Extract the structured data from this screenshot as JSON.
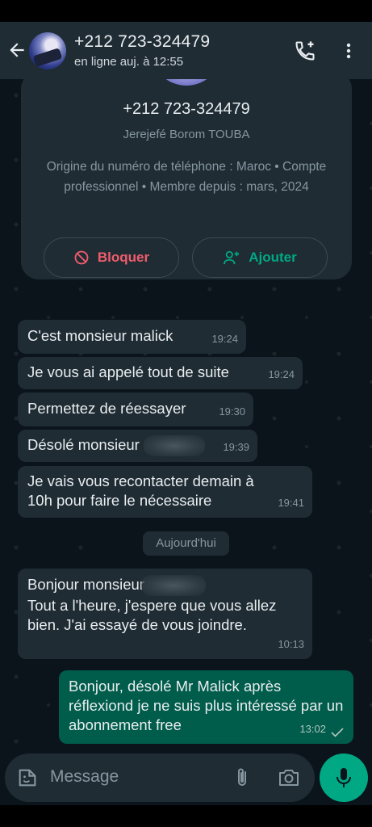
{
  "header": {
    "contact_name": "+212 723-324479",
    "status": "en ligne auj. à 12:55"
  },
  "contact_card": {
    "phone": "+212 723-324479",
    "business_name": "Jerejefé Borom TOUBA",
    "info": "Origine du numéro de téléphone : Maroc • Compte professionnel • Membre depuis : mars, 2024",
    "block_label": "Bloquer",
    "add_label": "Ajouter"
  },
  "messages": [
    {
      "text": "C'est  monsieur malick",
      "time": "19:24"
    },
    {
      "text": "Je vous ai appelé tout de suite",
      "time": "19:24"
    },
    {
      "text": "Permettez de réessayer",
      "time": "19:30"
    },
    {
      "text": "Désolé monsieur",
      "time": "19:39"
    },
    {
      "text": "Je vais vous recontacter demain à 10h pour faire le nécessaire",
      "time": "19:41"
    },
    {
      "line1": "Bonjour monsieur",
      "line2": "Tout a l'heure, j'espere que vous allez bien. J'ai essayé de vous joindre.",
      "time": "10:13"
    },
    {
      "text": "Bonjour, désolé Mr Malick après réflexiond je ne suis plus intéressé par un abonnement free",
      "time": "13:02"
    }
  ],
  "day_separator": "Aujourd'hui",
  "composer": {
    "placeholder": "Message"
  },
  "colors": {
    "header_bg": "#1f2c34",
    "chat_bg": "#0b141a",
    "incoming_bubble": "#1f2c34",
    "outgoing_bubble": "#005c4b",
    "accent_green": "#00a884",
    "block_red": "#f15c6d"
  },
  "icons": [
    "back-arrow-icon",
    "add-call-icon",
    "more-vert-icon",
    "block-icon",
    "add-person-icon",
    "sticker-icon",
    "attach-icon",
    "camera-icon",
    "mic-icon",
    "read-tick-icon"
  ]
}
